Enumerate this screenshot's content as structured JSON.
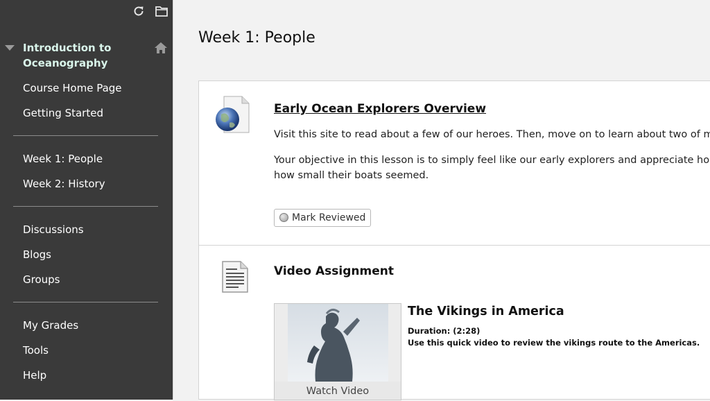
{
  "sidebar": {
    "top_icons": [
      "refresh-icon",
      "folder-icon"
    ],
    "course_title": "Introduction to Oceanography",
    "groups": [
      [
        "Course Home Page",
        "Getting Started"
      ],
      [
        "Week 1: People",
        "Week 2: History"
      ],
      [
        "Discussions",
        "Blogs",
        "Groups"
      ],
      [
        "My Grades",
        "Tools",
        "Help"
      ]
    ]
  },
  "main": {
    "page_title": "Week 1: People",
    "items": [
      {
        "icon": "web-link-globe-icon",
        "title": "Early Ocean Explorers Overview",
        "paragraphs": [
          "Visit this site to read about a few of our heroes. Then, move on to learn about two of m",
          "Your objective in this lesson is to simply feel like our early explorers and appreciate ho",
          "how small their boats seemed."
        ],
        "button_label": "Mark Reviewed"
      },
      {
        "icon": "document-icon",
        "title": "Video Assignment",
        "video": {
          "watch_label": "Watch Video",
          "title": "The Vikings in America",
          "duration": "Duration: (2:28)",
          "description": "Use this quick video to review the vikings route to the Americas."
        }
      }
    ]
  },
  "colors": {
    "sidebar_bg": "#3a3a3a",
    "course_title": "#d9f5ea",
    "page_bg": "#f2f2f2"
  }
}
